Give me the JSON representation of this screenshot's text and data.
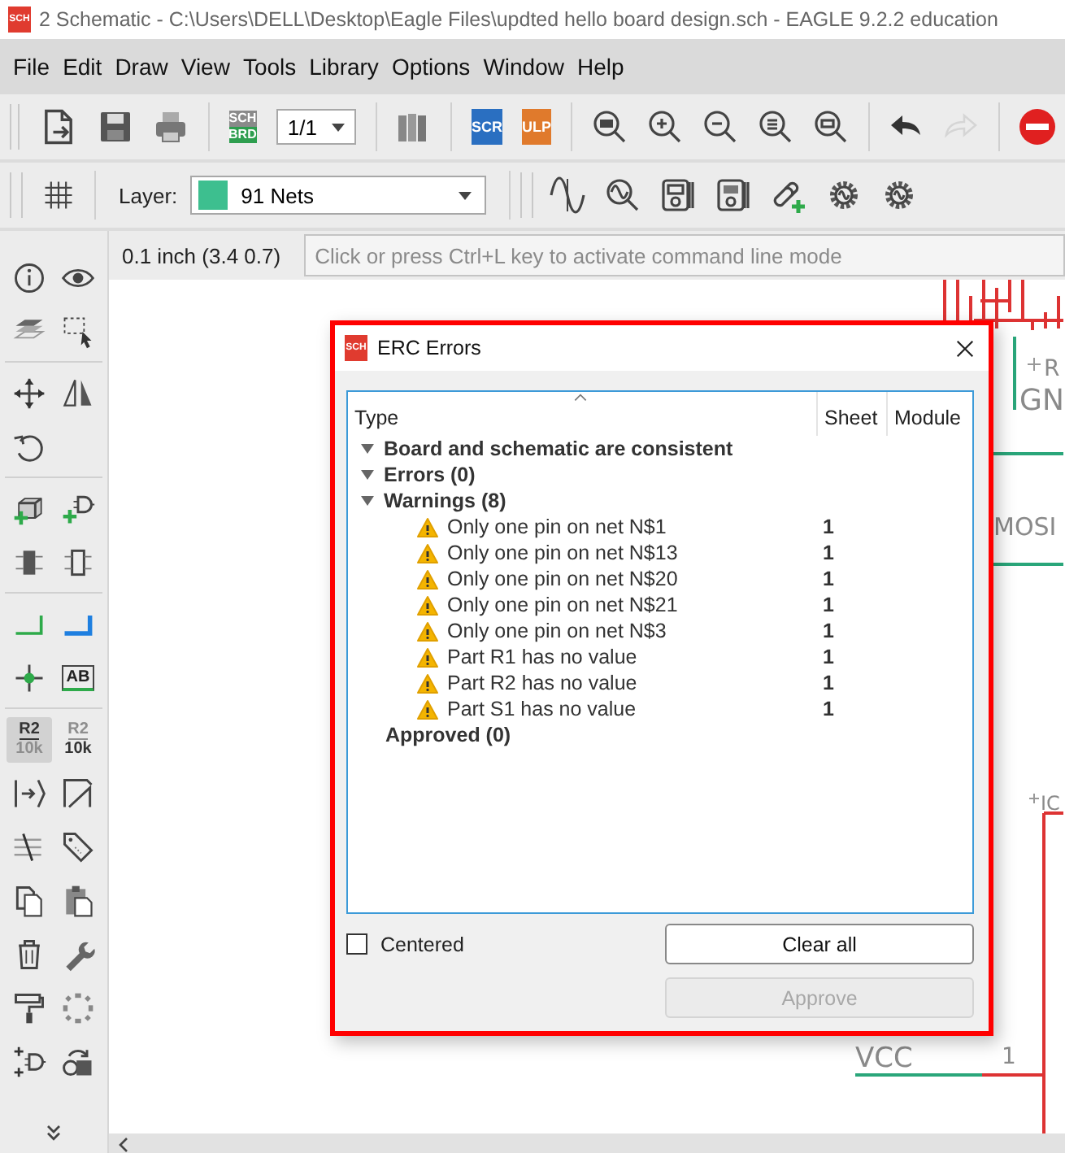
{
  "window": {
    "title": "2 Schematic - C:\\Users\\DELL\\Desktop\\Eagle Files\\updted hello board design.sch - EAGLE 9.2.2 education",
    "icon_text": "SCH"
  },
  "menu": [
    "File",
    "Edit",
    "Draw",
    "View",
    "Tools",
    "Library",
    "Options",
    "Window",
    "Help"
  ],
  "toolbar": {
    "board_switch": [
      "SCH",
      "BRD"
    ],
    "sheet": "1/1",
    "script": "SCR",
    "ulp": "ULP",
    "undo": {
      "disabled": false
    },
    "redo": {
      "disabled": true
    }
  },
  "layer_bar": {
    "label": "Layer:",
    "layer": "91 Nets"
  },
  "coordinates": "0.1 inch (3.4 0.7)",
  "command_line": {
    "placeholder": "Click or press Ctrl+L key to activate command line mode"
  },
  "tools": {
    "label_text": "AB",
    "name_tool": {
      "selected": true,
      "top": "R2",
      "bottom": "10k"
    },
    "value_tool": {
      "selected": false,
      "top": "R2",
      "bottom": "10k"
    }
  },
  "canvas": {
    "labels": [
      "R",
      "GN",
      "MOSI",
      "IC",
      "VCC",
      "1"
    ]
  },
  "dialog": {
    "title": "ERC Errors",
    "icon_text": "SCH",
    "columns": [
      "Type",
      "Sheet",
      "Module"
    ],
    "groups": [
      {
        "label": "Board and schematic are consistent",
        "kind": "toggle",
        "expanded": true
      },
      {
        "label": "Errors (0)",
        "kind": "toggle",
        "expanded": true
      },
      {
        "label": "Warnings (8)",
        "kind": "toggle",
        "expanded": true,
        "children": [
          {
            "kind": "warning",
            "text": "Only one pin on net N$1",
            "sheet": "1"
          },
          {
            "kind": "warning",
            "text": "Only one pin on net N$13",
            "sheet": "1"
          },
          {
            "kind": "warning",
            "text": "Only one pin on net N$20",
            "sheet": "1"
          },
          {
            "kind": "warning",
            "text": "Only one pin on net N$21",
            "sheet": "1"
          },
          {
            "kind": "warning",
            "text": "Only one pin on net N$3",
            "sheet": "1"
          },
          {
            "kind": "warning",
            "text": "Part R1 has no value",
            "sheet": "1"
          },
          {
            "kind": "warning",
            "text": "Part R2 has no value",
            "sheet": "1"
          },
          {
            "kind": "warning",
            "text": "Part S1 has no value",
            "sheet": "1"
          }
        ]
      },
      {
        "label": "Approved (0)",
        "kind": "plain"
      }
    ],
    "centered": {
      "label": "Centered",
      "checked": false
    },
    "buttons": [
      {
        "label": "Clear all",
        "disabled": false
      },
      {
        "label": "Approve",
        "disabled": true
      }
    ]
  }
}
